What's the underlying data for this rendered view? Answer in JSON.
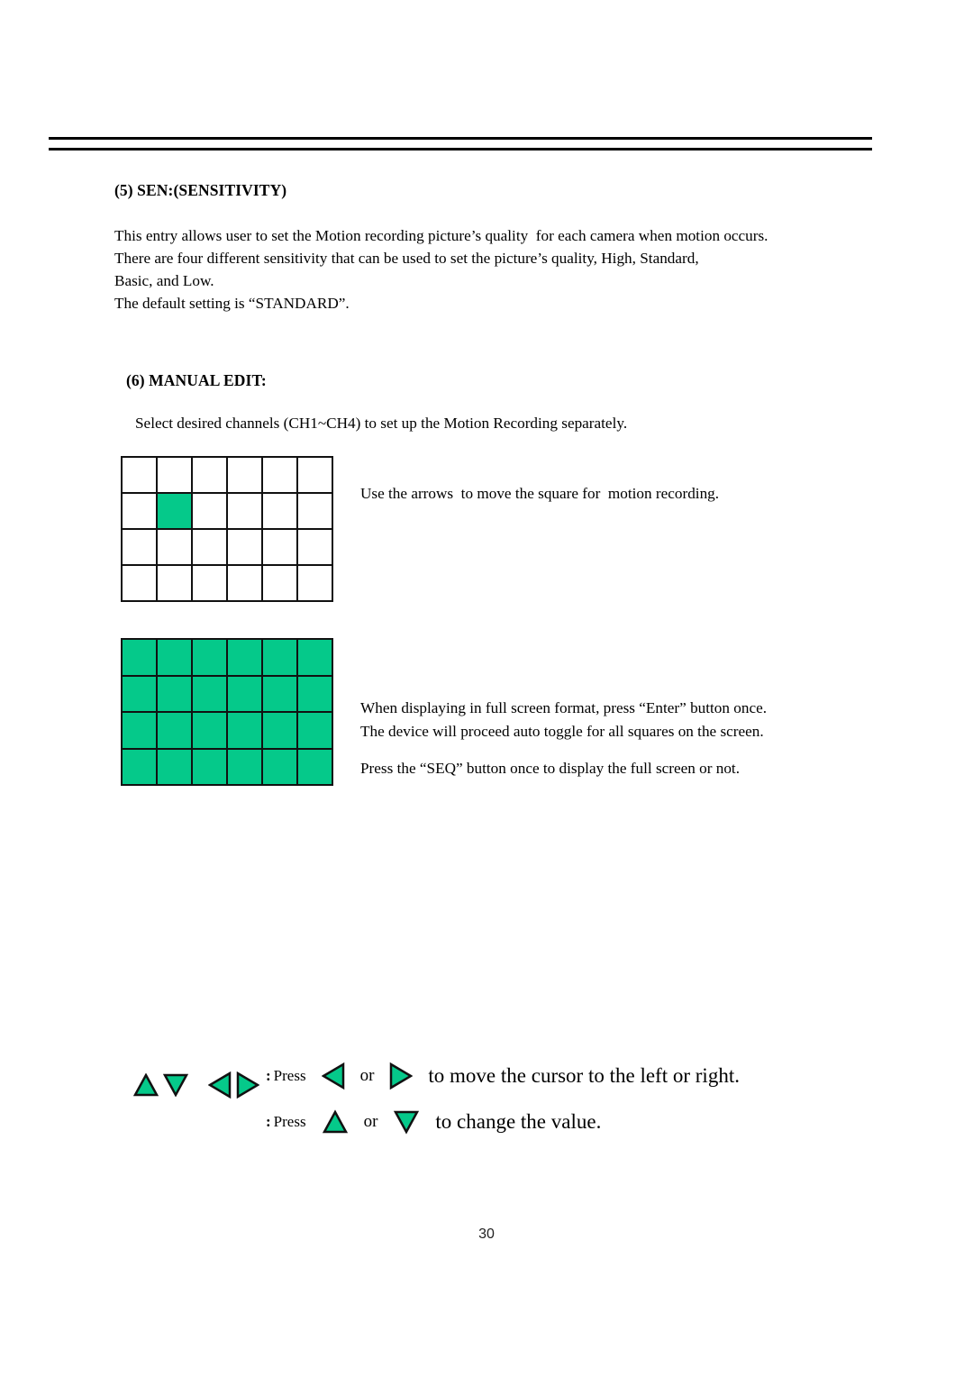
{
  "document": {
    "page_number": "30",
    "accent_green": "#05C98A",
    "rule_color": "#000000"
  },
  "sections": {
    "sensitivity": {
      "heading": "(5) SEN:(SENSITIVITY)",
      "body": "This entry allows user to set the Motion recording picture’s quality  for each camera when motion occurs.\nThere are four different sensitivity that can be used to set the picture’s quality, High, Standard,\nBasic, and Low.\nThe default setting is “STANDARD”."
    },
    "manual_edit": {
      "heading": "(6) MANUAL EDIT:",
      "intro": "Select desired channels (CH1~CH4) to set up the Motion Recording separately.",
      "cursor_grid_note": "Use the arrows  to move the square for  motion recording.",
      "full_screen_note": "When displaying in full screen format, press “Enter” button once.\nThe device will proceed auto toggle for all squares on the screen.",
      "seq_note": "Press the “SEQ” button once to display the full screen or not."
    }
  },
  "grids": {
    "cursor_grid": {
      "columns": 6,
      "rows": 4,
      "selected_cell": {
        "row": 2,
        "column": 2
      },
      "cells": [
        [
          0,
          0,
          0,
          0,
          0,
          0
        ],
        [
          0,
          1,
          0,
          0,
          0,
          0
        ],
        [
          0,
          0,
          0,
          0,
          0,
          0
        ],
        [
          0,
          0,
          0,
          0,
          0,
          0
        ]
      ]
    },
    "full_grid": {
      "columns": 6,
      "rows": 4,
      "cells": [
        [
          1,
          1,
          1,
          1,
          1,
          1
        ],
        [
          1,
          1,
          1,
          1,
          1,
          1
        ],
        [
          1,
          1,
          1,
          1,
          1,
          1
        ],
        [
          1,
          1,
          1,
          1,
          1,
          1
        ]
      ]
    }
  },
  "legend": {
    "key_icons": [
      "up-arrow",
      "down-arrow",
      "left-arrow",
      "right-arrow"
    ],
    "lines": [
      {
        "colon": ":",
        "press": "Press",
        "first_icon": "left-arrow",
        "conjunction": "or",
        "second_icon": "right-arrow",
        "tail": "to move the cursor to the left or right."
      },
      {
        "colon": ":",
        "press": "Press",
        "first_icon": "up-arrow",
        "conjunction": "or",
        "second_icon": "down-arrow",
        "tail": "to change the value."
      }
    ]
  }
}
